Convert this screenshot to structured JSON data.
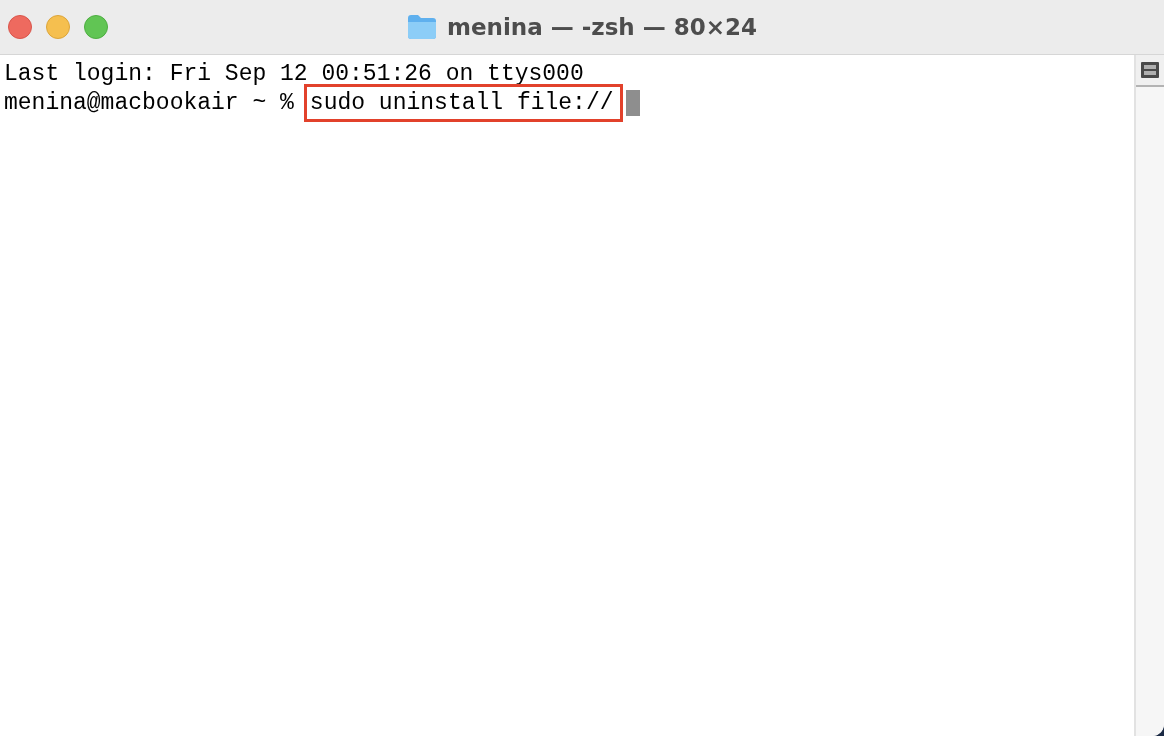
{
  "window": {
    "title": "menina — -zsh — 80×24"
  },
  "terminal": {
    "lines": [
      {
        "kind": "output",
        "text": "Last login: Fri Sep 12 00:51:26 on ttys000"
      },
      {
        "kind": "prompt",
        "prompt": "menina@macbookair ~ %",
        "command": "sudo uninstall file://",
        "highlighted": true,
        "cursor": true
      }
    ]
  }
}
